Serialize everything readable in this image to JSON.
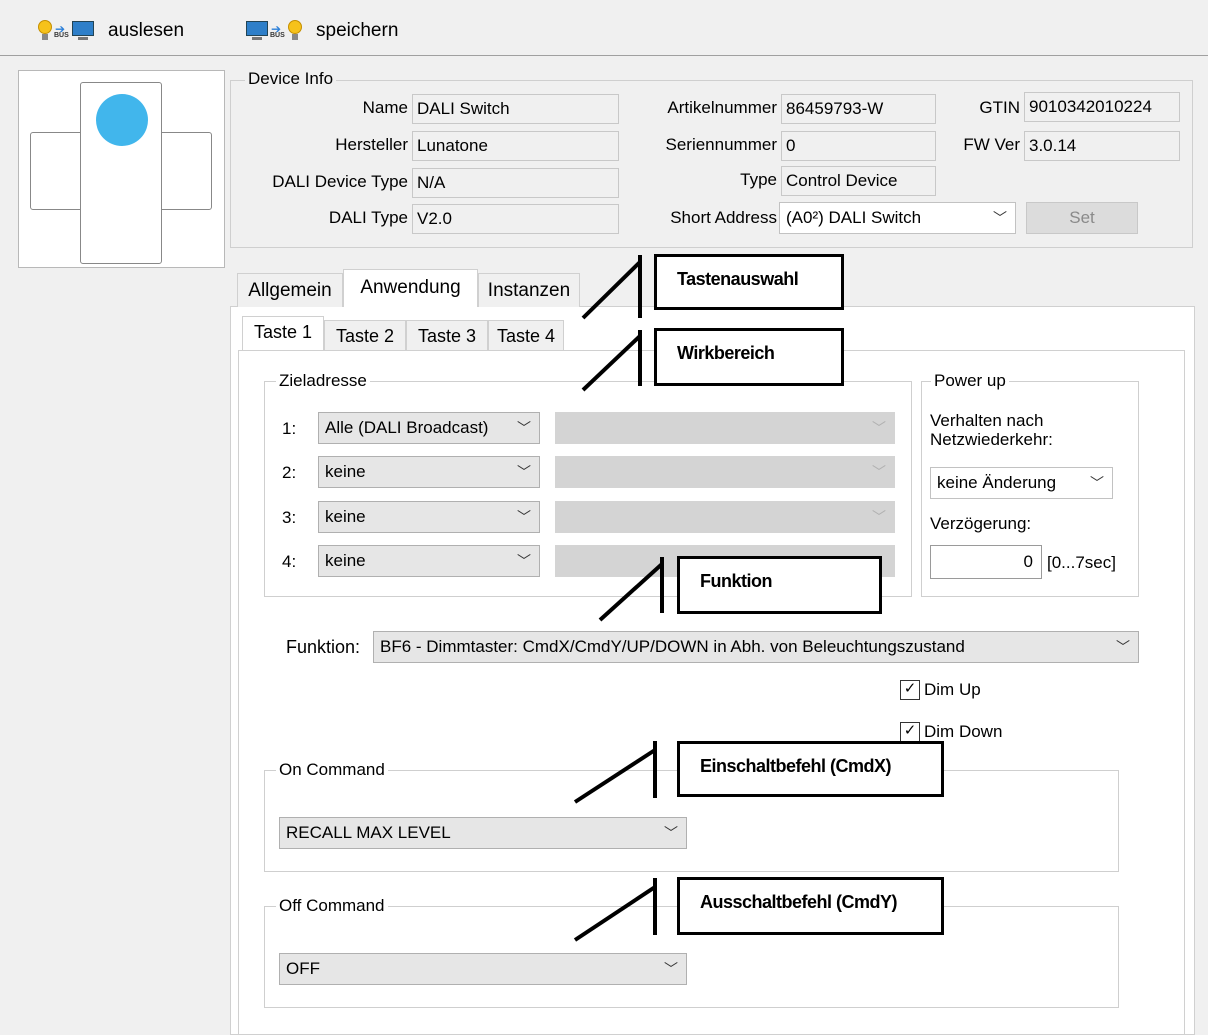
{
  "toolbar": {
    "read_label": "auslesen",
    "save_label": "speichern"
  },
  "device_info": {
    "title": "Device Info",
    "name_label": "Name",
    "name_value": "DALI Switch",
    "manufacturer_label": "Hersteller",
    "manufacturer_value": "Lunatone",
    "device_type_label": "DALI Device Type",
    "device_type_value": "N/A",
    "dali_type_label": "DALI Type",
    "dali_type_value": "V2.0",
    "article_label": "Artikelnummer",
    "article_value": "86459793-W",
    "serial_label": "Seriennummer",
    "serial_value": "0",
    "type_label": "Type",
    "type_value": "Control Device",
    "short_address_label": "Short Address",
    "short_address_value": "(A0²) DALI Switch",
    "gtin_label": "GTIN",
    "gtin_value": "9010342010224",
    "fw_label": "FW Ver",
    "fw_value": "3.0.14",
    "set_label": "Set"
  },
  "tabs": [
    "Allgemein",
    "Anwendung",
    "Instanzen"
  ],
  "subtabs": [
    "Taste 1",
    "Taste 2",
    "Taste 3",
    "Taste 4"
  ],
  "target": {
    "title": "Zieladresse",
    "rows": [
      {
        "num": "1:",
        "value": "Alle (DALI Broadcast)"
      },
      {
        "num": "2:",
        "value": "keine"
      },
      {
        "num": "3:",
        "value": "keine"
      },
      {
        "num": "4:",
        "value": "keine"
      }
    ]
  },
  "power_up": {
    "title": "Power up",
    "behaviour_label": "Verhalten nach Netzwiederkehr:",
    "behaviour_value": "keine Änderung",
    "delay_label": "Verzögerung:",
    "delay_value": "0",
    "delay_unit": "[0...7sec]"
  },
  "function": {
    "label": "Funktion:",
    "value": "BF6 - Dimmtaster:  CmdX/CmdY/UP/DOWN in Abh. von Beleuchtungszustand",
    "dim_up_label": "Dim Up",
    "dim_down_label": "Dim Down",
    "dim_up_checked": true,
    "dim_down_checked": true
  },
  "on_command": {
    "title": "On Command",
    "value": "RECALL MAX LEVEL"
  },
  "off_command": {
    "title": "Off Command",
    "value": "OFF"
  },
  "callouts": {
    "tastenauswahl": "Tastenauswahl",
    "wirkbereich": "Wirkbereich",
    "funktion": "Funktion",
    "einschaltbefehl": "Einschaltbefehl (CmdX)",
    "ausschaltbefehl": "Ausschaltbefehl (CmdY)"
  },
  "icons": {
    "read": [
      "bulb-icon",
      "bus-arrow-icon",
      "monitor-icon"
    ],
    "save": [
      "monitor-icon",
      "bus-arrow-icon",
      "bulb-icon"
    ],
    "chevron": "chevron-down-icon"
  },
  "colors": {
    "accent_dot": "#41b6ec",
    "background": "#f0f0f0",
    "panel": "#ffffff"
  }
}
